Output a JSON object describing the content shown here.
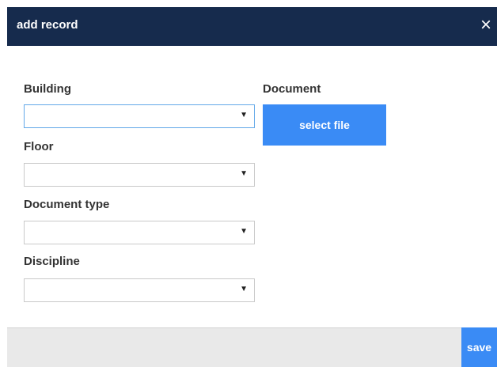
{
  "dialog": {
    "title": "add record",
    "close_icon": "×"
  },
  "form": {
    "building": {
      "label": "Building",
      "value": ""
    },
    "floor": {
      "label": "Floor",
      "value": ""
    },
    "document_type": {
      "label": "Document type",
      "value": ""
    },
    "discipline": {
      "label": "Discipline",
      "value": ""
    },
    "document": {
      "label": "Document",
      "button_label": "select file"
    },
    "dropdown_arrow": "▼"
  },
  "footer": {
    "save_label": "save"
  },
  "colors": {
    "header_bg": "#162b4d",
    "accent": "#3a8bf5",
    "footer_bg": "#e9e9e9",
    "focus_border": "#62a8e8"
  }
}
